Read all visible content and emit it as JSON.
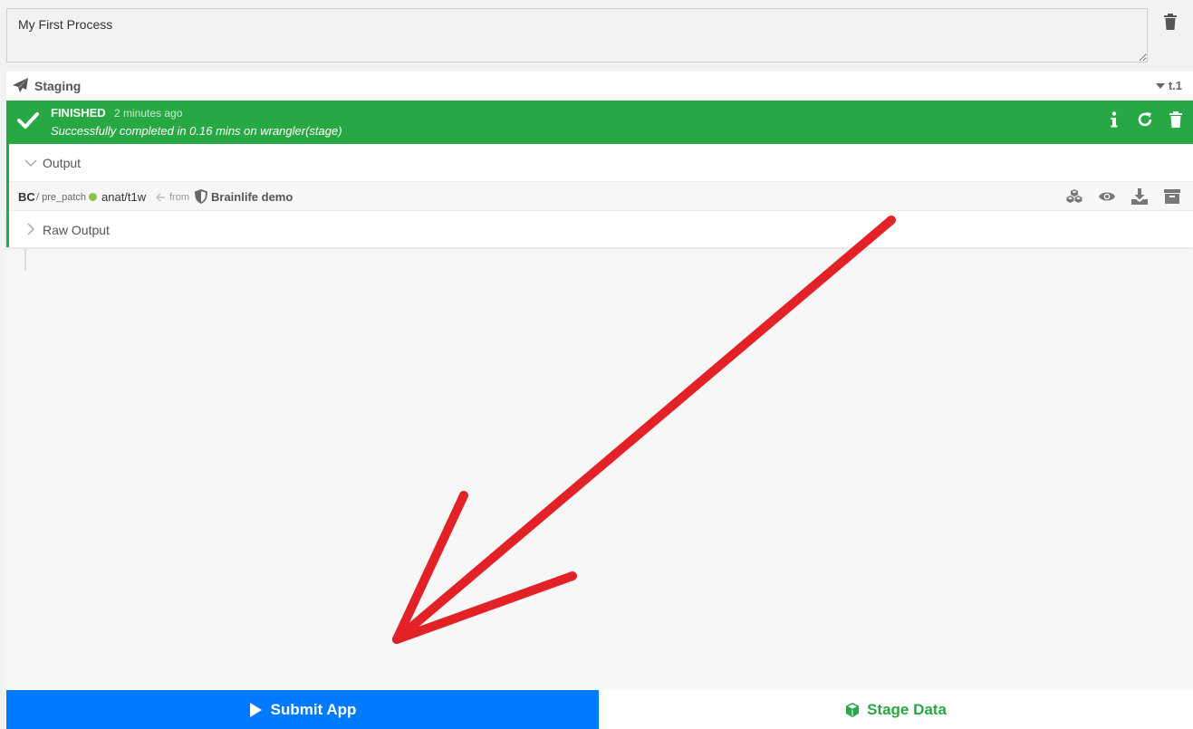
{
  "description": {
    "value": "My First Process"
  },
  "task": {
    "name": "Staging",
    "id": "t.1",
    "status": "FINISHED",
    "time_ago": "2 minutes ago",
    "message": "Successfully completed in 0.16 mins on wrangler(stage)"
  },
  "output": {
    "label": "Output",
    "dataset": {
      "datatype": "BC",
      "separator": "/ pre_patch",
      "tag": "anat/t1w",
      "from_label": "from",
      "project": "Brainlife demo"
    }
  },
  "raw_output": {
    "label": "Raw Output"
  },
  "buttons": {
    "submit_app": "Submit App",
    "stage_data": "Stage Data"
  },
  "icons": {
    "delete": "trash-icon",
    "staging": "paper-plane-icon",
    "status": "check-icon",
    "info": "info-icon",
    "rerun": "redo-icon",
    "dataset_tools": "cubes-icon",
    "view": "eye-icon",
    "download": "download-icon",
    "archive": "archive-icon",
    "project": "shield-icon",
    "submit": "play-icon",
    "stage": "cube-icon"
  },
  "colors": {
    "success": "#28a745",
    "primary": "#007bff",
    "annotation": "#e32227"
  }
}
